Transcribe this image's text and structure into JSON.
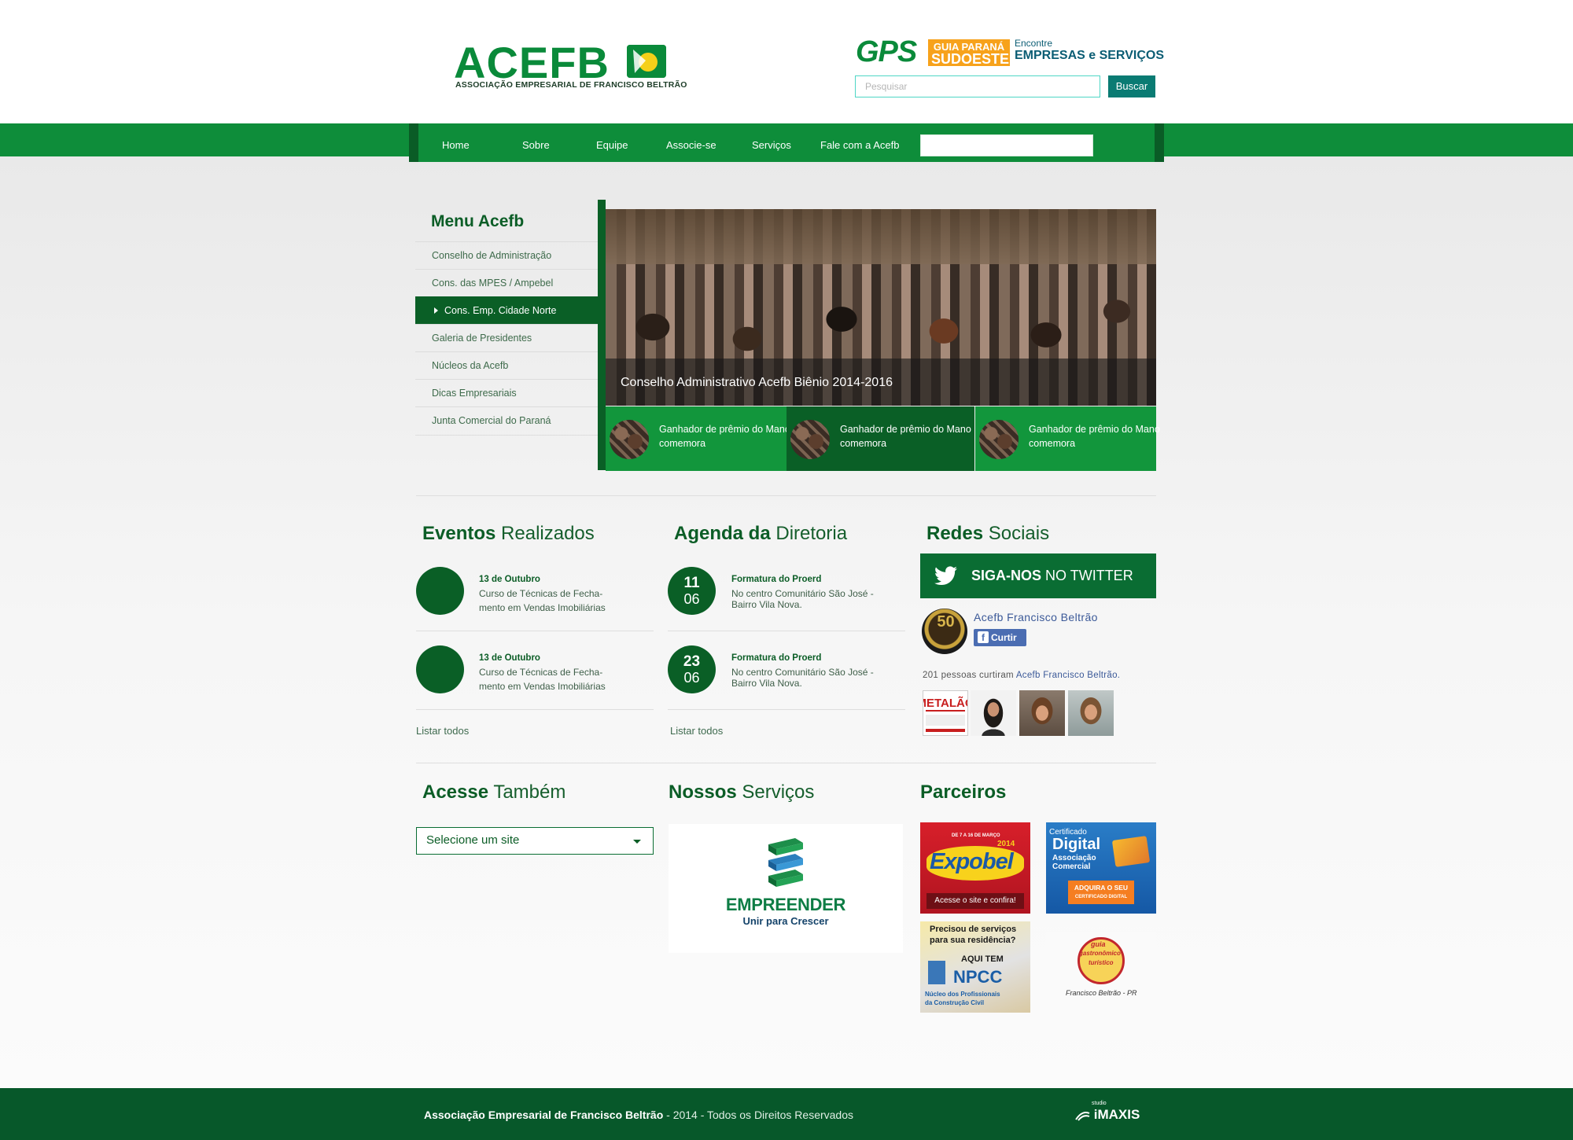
{
  "header": {
    "logo_text": "ACEFB",
    "logo_tagline": "ASSOCIAÇÃO EMPRESARIAL DE FRANCISCO BELTRÃO",
    "gps": {
      "brand": "GPS",
      "guide_line1": "GUIA PARANÁ",
      "guide_line2": "SUDOESTE",
      "encontre": "Encontre",
      "empresas_line": "EMPRESAS e SERVIÇOS"
    },
    "search": {
      "placeholder": "Pesquisar",
      "button_label": "Buscar"
    }
  },
  "nav": {
    "items": [
      {
        "label": "Home"
      },
      {
        "label": "Sobre"
      },
      {
        "label": "Equipe"
      },
      {
        "label": "Associe-se"
      },
      {
        "label": "Serviços"
      },
      {
        "label": "Fale com a Acefb"
      }
    ]
  },
  "sidebar": {
    "title": "Menu Acefb",
    "items": [
      {
        "label": "Conselho de Administração"
      },
      {
        "label": "Cons. das MPES / Ampebel"
      },
      {
        "label": "Cons. Emp. Cidade Norte"
      },
      {
        "label": "Galeria de Presidentes"
      },
      {
        "label": "Núcleos da Acefb"
      },
      {
        "label": "Dicas Empresariais"
      },
      {
        "label": "Junta Comercial do Paraná"
      }
    ],
    "active_index": 2
  },
  "slider": {
    "caption": "Conselho Administrativo Acefb Biênio 2014-2016",
    "thumbs": [
      {
        "text": "Ganhador de prêmio do Mano comemora"
      },
      {
        "text": "Ganhador de prêmio do Mano comemora"
      },
      {
        "text": "Ganhador de prêmio do Mano comemora"
      }
    ]
  },
  "eventos": {
    "title_bold": "Eventos",
    "title_rest": "Realizados",
    "items": [
      {
        "title": "13 de Outubro",
        "desc1": "Curso de Técnicas de Fecha-",
        "desc2": "mento em Vendas Imobiliárias"
      },
      {
        "title": "13 de Outubro",
        "desc1": "Curso de Técnicas de Fecha-",
        "desc2": "mento em Vendas Imobiliárias"
      }
    ],
    "list_all": "Listar todos"
  },
  "agenda": {
    "title_bold": "Agenda da",
    "title_rest": "Diretoria",
    "items": [
      {
        "day": "11",
        "month": "06",
        "title": "Formatura do Proerd",
        "desc1": "No centro Comunitário São José -",
        "desc2": "Bairro Vila Nova."
      },
      {
        "day": "23",
        "month": "06",
        "title": "Formatura do Proerd",
        "desc1": "No centro Comunitário São José -",
        "desc2": "Bairro Vila Nova."
      }
    ],
    "list_all": "Listar todos"
  },
  "redes": {
    "title_bold": "Redes",
    "title_rest": "Sociais",
    "twitter_bold": "SIGA-NOS",
    "twitter_rest": "NO TWITTER",
    "fb_logo_text": "50",
    "fb_page": "Acefb Francisco Beltrão",
    "fb_like": "Curtir",
    "fb_count_prefix": "201 pessoas curtiram",
    "fb_count_link": "Acefb Francisco Beltrão."
  },
  "acesse": {
    "title_bold": "Acesse",
    "title_rest": "Também",
    "select_value": "Selecione um site"
  },
  "servicos": {
    "title_bold": "Nossos",
    "title_rest": "Serviços",
    "emp_name": "EMPREENDER",
    "emp_sub": "Unir para Crescer"
  },
  "parceiros": {
    "title": "Parceiros",
    "expobel": {
      "date": "DE 7 A 16 DE MARÇO",
      "year": "2014",
      "name": "Expobel",
      "cta": "Acesse o site e confira!"
    },
    "cert": {
      "line1": "Certificado",
      "line2": "Digital",
      "line3": "Associação",
      "line4": "Comercial",
      "cta1": "ADQUIRA O SEU",
      "cta2": "CERTIFICADO DIGITAL"
    },
    "npcc": {
      "q1": "Precisou de serviços",
      "q2": "para sua residência?",
      "aqui": "AQUI TEM",
      "name": "NPCC",
      "sub1": "Núcleo dos Profissionais",
      "sub2": "da Construção Civil"
    },
    "guia": {
      "l1": "guia",
      "l2": "gastronômico",
      "l3": "turístico",
      "place": "Francisco Beltrão - PR"
    }
  },
  "footer": {
    "org": "Associação Empresarial de Francisco Beltrão",
    "rest": " - 2014 - Todos os Direitos Reservados",
    "credit_small": "studio",
    "credit": "iMAXIS"
  },
  "colors": {
    "primary_green": "#0e8d3a",
    "dark_green": "#0a5f26",
    "footer_green": "#07582a"
  }
}
